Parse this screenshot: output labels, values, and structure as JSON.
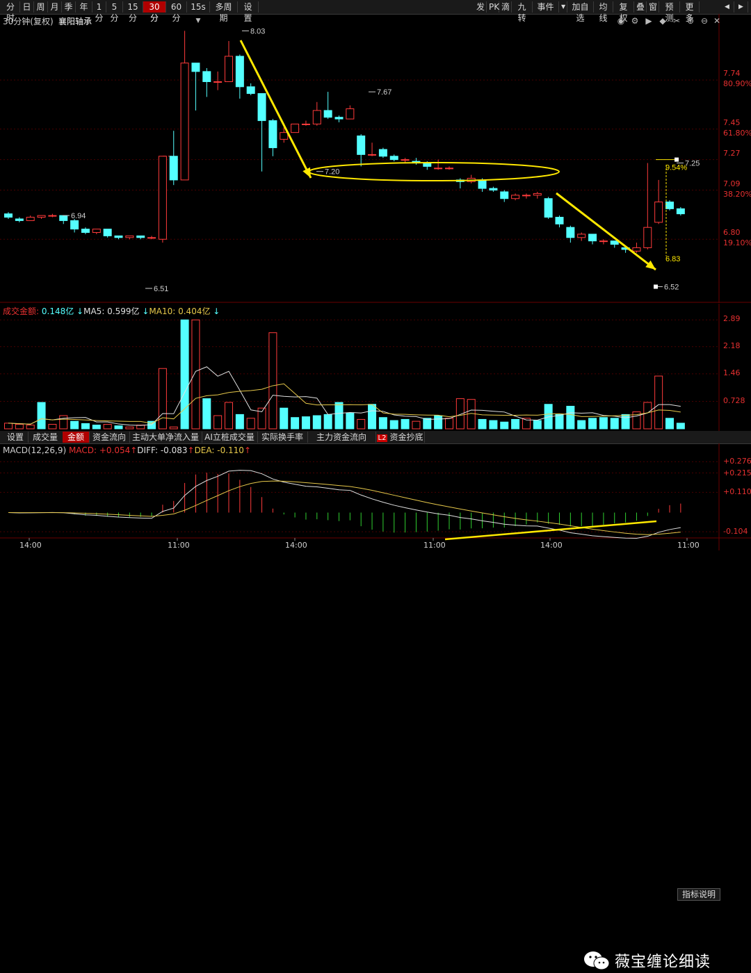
{
  "toolbar": {
    "left": [
      "分时",
      "日",
      "周",
      "月",
      "季",
      "年",
      "1分",
      "5分",
      "15分",
      "30分",
      "60分",
      "15s",
      "多周期",
      "设置"
    ],
    "active": "30分",
    "right": [
      "发",
      "PK",
      "滴",
      "九转",
      "事件",
      "加自选",
      "均线",
      "复权",
      "叠",
      "窗",
      "预测",
      "更多"
    ]
  },
  "chart": {
    "period_label": "30分钟(复权)",
    "stock_name": "襄阳轴承"
  },
  "price_axis": [
    {
      "v": "7.74",
      "p": "80.90%"
    },
    {
      "v": "7.45",
      "p": "61.80%"
    },
    {
      "v": "7.27",
      "p": ""
    },
    {
      "v": "7.09",
      "p": "38.20%"
    },
    {
      "v": "6.80",
      "p": "19.10%"
    }
  ],
  "candles": [
    {
      "o": 6.95,
      "c": 6.93,
      "h": 6.96,
      "l": 6.92
    },
    {
      "o": 6.92,
      "c": 6.91,
      "h": 6.93,
      "l": 6.9
    },
    {
      "o": 6.91,
      "c": 6.93,
      "h": 6.94,
      "l": 6.91
    },
    {
      "o": 6.93,
      "c": 6.94,
      "h": 6.94,
      "l": 6.92
    },
    {
      "o": 6.94,
      "c": 6.94,
      "h": 6.95,
      "l": 6.93
    },
    {
      "o": 6.94,
      "c": 6.91,
      "h": 6.94,
      "l": 6.89
    },
    {
      "o": 6.91,
      "c": 6.86,
      "h": 6.92,
      "l": 6.84
    },
    {
      "o": 6.86,
      "c": 6.84,
      "h": 6.87,
      "l": 6.83
    },
    {
      "o": 6.84,
      "c": 6.86,
      "h": 6.86,
      "l": 6.83
    },
    {
      "o": 6.86,
      "c": 6.82,
      "h": 6.86,
      "l": 6.81
    },
    {
      "o": 6.82,
      "c": 6.81,
      "h": 6.82,
      "l": 6.8
    },
    {
      "o": 6.81,
      "c": 6.82,
      "h": 6.82,
      "l": 6.8
    },
    {
      "o": 6.82,
      "c": 6.81,
      "h": 6.82,
      "l": 6.8
    },
    {
      "o": 6.81,
      "c": 6.81,
      "h": 6.82,
      "l": 6.8
    },
    {
      "o": 6.8,
      "c": 7.29,
      "h": 7.29,
      "l": 6.78
    },
    {
      "o": 7.29,
      "c": 7.15,
      "h": 7.44,
      "l": 7.12
    },
    {
      "o": 7.15,
      "c": 7.84,
      "h": 8.03,
      "l": 7.15
    },
    {
      "o": 7.84,
      "c": 7.79,
      "h": 7.84,
      "l": 7.56
    },
    {
      "o": 7.79,
      "c": 7.73,
      "h": 7.81,
      "l": 7.64
    },
    {
      "o": 7.73,
      "c": 7.73,
      "h": 7.79,
      "l": 7.68
    },
    {
      "o": 7.73,
      "c": 7.88,
      "h": 7.97,
      "l": 7.73
    },
    {
      "o": 7.88,
      "c": 7.7,
      "h": 7.89,
      "l": 7.63
    },
    {
      "o": 7.7,
      "c": 7.66,
      "h": 7.72,
      "l": 7.65
    },
    {
      "o": 7.66,
      "c": 7.5,
      "h": 7.59,
      "l": 7.2
    },
    {
      "o": 7.5,
      "c": 7.34,
      "h": 7.51,
      "l": 7.29
    },
    {
      "o": 7.39,
      "c": 7.43,
      "h": 7.46,
      "l": 7.37
    },
    {
      "o": 7.43,
      "c": 7.48,
      "h": 7.48,
      "l": 7.43
    },
    {
      "o": 7.48,
      "c": 7.48,
      "h": 7.5,
      "l": 7.47
    },
    {
      "o": 7.48,
      "c": 7.56,
      "h": 7.61,
      "l": 7.47
    },
    {
      "o": 7.56,
      "c": 7.52,
      "h": 7.67,
      "l": 7.51
    },
    {
      "o": 7.52,
      "c": 7.51,
      "h": 7.53,
      "l": 7.49
    },
    {
      "o": 7.51,
      "c": 7.57,
      "h": 7.59,
      "l": 7.51
    },
    {
      "o": 7.41,
      "c": 7.3,
      "h": 7.42,
      "l": 7.23
    },
    {
      "o": 7.3,
      "c": 7.3,
      "h": 7.37,
      "l": 7.29
    },
    {
      "o": 7.33,
      "c": 7.29,
      "h": 7.34,
      "l": 7.28
    },
    {
      "o": 7.29,
      "c": 7.27,
      "h": 7.3,
      "l": 7.26
    },
    {
      "o": 7.27,
      "c": 7.27,
      "h": 7.28,
      "l": 7.25
    },
    {
      "o": 7.26,
      "c": 7.25,
      "h": 7.28,
      "l": 7.24
    },
    {
      "o": 7.25,
      "c": 7.23,
      "h": 7.26,
      "l": 7.21
    },
    {
      "o": 7.22,
      "c": 7.22,
      "h": 7.27,
      "l": 7.21
    },
    {
      "o": 7.22,
      "c": 7.22,
      "h": 7.23,
      "l": 7.21
    },
    {
      "o": 7.15,
      "c": 7.14,
      "h": 7.16,
      "l": 7.1
    },
    {
      "o": 7.14,
      "c": 7.16,
      "h": 7.18,
      "l": 7.13
    },
    {
      "o": 7.15,
      "c": 7.1,
      "h": 7.16,
      "l": 7.08
    },
    {
      "o": 7.1,
      "c": 7.09,
      "h": 7.11,
      "l": 7.08
    },
    {
      "o": 7.08,
      "c": 7.04,
      "h": 7.09,
      "l": 7.02
    },
    {
      "o": 7.04,
      "c": 7.06,
      "h": 7.07,
      "l": 7.03
    },
    {
      "o": 7.06,
      "c": 7.06,
      "h": 7.07,
      "l": 7.04
    },
    {
      "o": 7.06,
      "c": 7.07,
      "h": 7.08,
      "l": 7.04
    },
    {
      "o": 7.04,
      "c": 6.93,
      "h": 7.05,
      "l": 6.92
    },
    {
      "o": 6.93,
      "c": 6.89,
      "h": 6.94,
      "l": 6.87
    },
    {
      "o": 6.87,
      "c": 6.81,
      "h": 6.88,
      "l": 6.78
    },
    {
      "o": 6.81,
      "c": 6.83,
      "h": 6.84,
      "l": 6.79
    },
    {
      "o": 6.83,
      "c": 6.79,
      "h": 6.83,
      "l": 6.77
    },
    {
      "o": 6.79,
      "c": 6.79,
      "h": 6.8,
      "l": 6.77
    },
    {
      "o": 6.79,
      "c": 6.77,
      "h": 6.79,
      "l": 6.75
    },
    {
      "o": 6.75,
      "c": 6.74,
      "h": 6.76,
      "l": 6.72
    },
    {
      "o": 6.73,
      "c": 6.75,
      "h": 6.78,
      "l": 6.72
    },
    {
      "o": 6.75,
      "c": 6.87,
      "h": 7.25,
      "l": 6.74
    },
    {
      "o": 6.9,
      "c": 7.02,
      "h": 7.15,
      "l": 6.89
    },
    {
      "o": 7.02,
      "c": 6.98,
      "h": 7.03,
      "l": 6.97
    },
    {
      "o": 6.98,
      "c": 6.95,
      "h": 6.99,
      "l": 6.94
    }
  ],
  "annotations": {
    "high": "8.03",
    "low": "6.51",
    "mark_694": "6.94",
    "mark_767": "7.67",
    "mark_720": "7.20",
    "mark_725": "7.25",
    "mark_683": "6.83",
    "mark_652": "6.52",
    "pct_label": "9.54%"
  },
  "vol_header": {
    "name": "成交金额",
    "value": "0.148亿",
    "ma5_label": "MA5",
    "ma5": "0.599亿",
    "ma10_label": "MA10",
    "ma10": "0.404亿"
  },
  "vol_axis": [
    "2.89",
    "2.18",
    "1.46",
    "0.728"
  ],
  "volumes": [
    0.15,
    0.12,
    0.1,
    0.7,
    0.12,
    0.35,
    0.2,
    0.14,
    0.1,
    0.12,
    0.08,
    0.05,
    0.1,
    0.2,
    1.6,
    0.05,
    2.89,
    2.89,
    0.8,
    0.35,
    0.7,
    0.38,
    0.28,
    0.55,
    2.55,
    0.55,
    0.3,
    0.32,
    0.35,
    0.38,
    0.7,
    0.42,
    0.25,
    0.65,
    0.3,
    0.22,
    0.25,
    0.2,
    0.28,
    0.35,
    0.28,
    0.8,
    0.78,
    0.25,
    0.22,
    0.18,
    0.25,
    0.28,
    0.22,
    0.65,
    0.38,
    0.6,
    0.22,
    0.28,
    0.3,
    0.28,
    0.38,
    0.45,
    0.7,
    1.4,
    0.28,
    0.15
  ],
  "vol_colors": "rrrcrrcccrcrrcrrcrcrrcrrrcccccccrccccrccrrrccccrcccccccccrrrcc",
  "tabs": [
    "设置",
    "成交量",
    "金额",
    "资金流向",
    "主动大单净流入量",
    "AI立桩成交量",
    "实际换手率",
    "主力资金流向",
    "资金抄底"
  ],
  "active_tab": "金额",
  "tab_badge": "L2",
  "macd_header": {
    "name": "MACD(12,26,9)",
    "macd_label": "MACD",
    "macd": "+0.054",
    "diff_label": "DIFF",
    "diff": "-0.083",
    "dea_label": "DEA",
    "dea": "-0.110"
  },
  "macd_axis": [
    "+0.276",
    "+0.215",
    "+0.110",
    "-0.104"
  ],
  "macd_button": "指标说明",
  "time_axis": [
    "14:00",
    "11:00",
    "14:00",
    "11:00",
    "14:00",
    "11:00"
  ],
  "watermark": "薇宝缠论细读",
  "colors": {
    "up": "#ff3b3b",
    "down": "#54ffff",
    "ma5": "#e0e0e0",
    "ma10": "#e6c84a",
    "annot": "#ffe800"
  }
}
